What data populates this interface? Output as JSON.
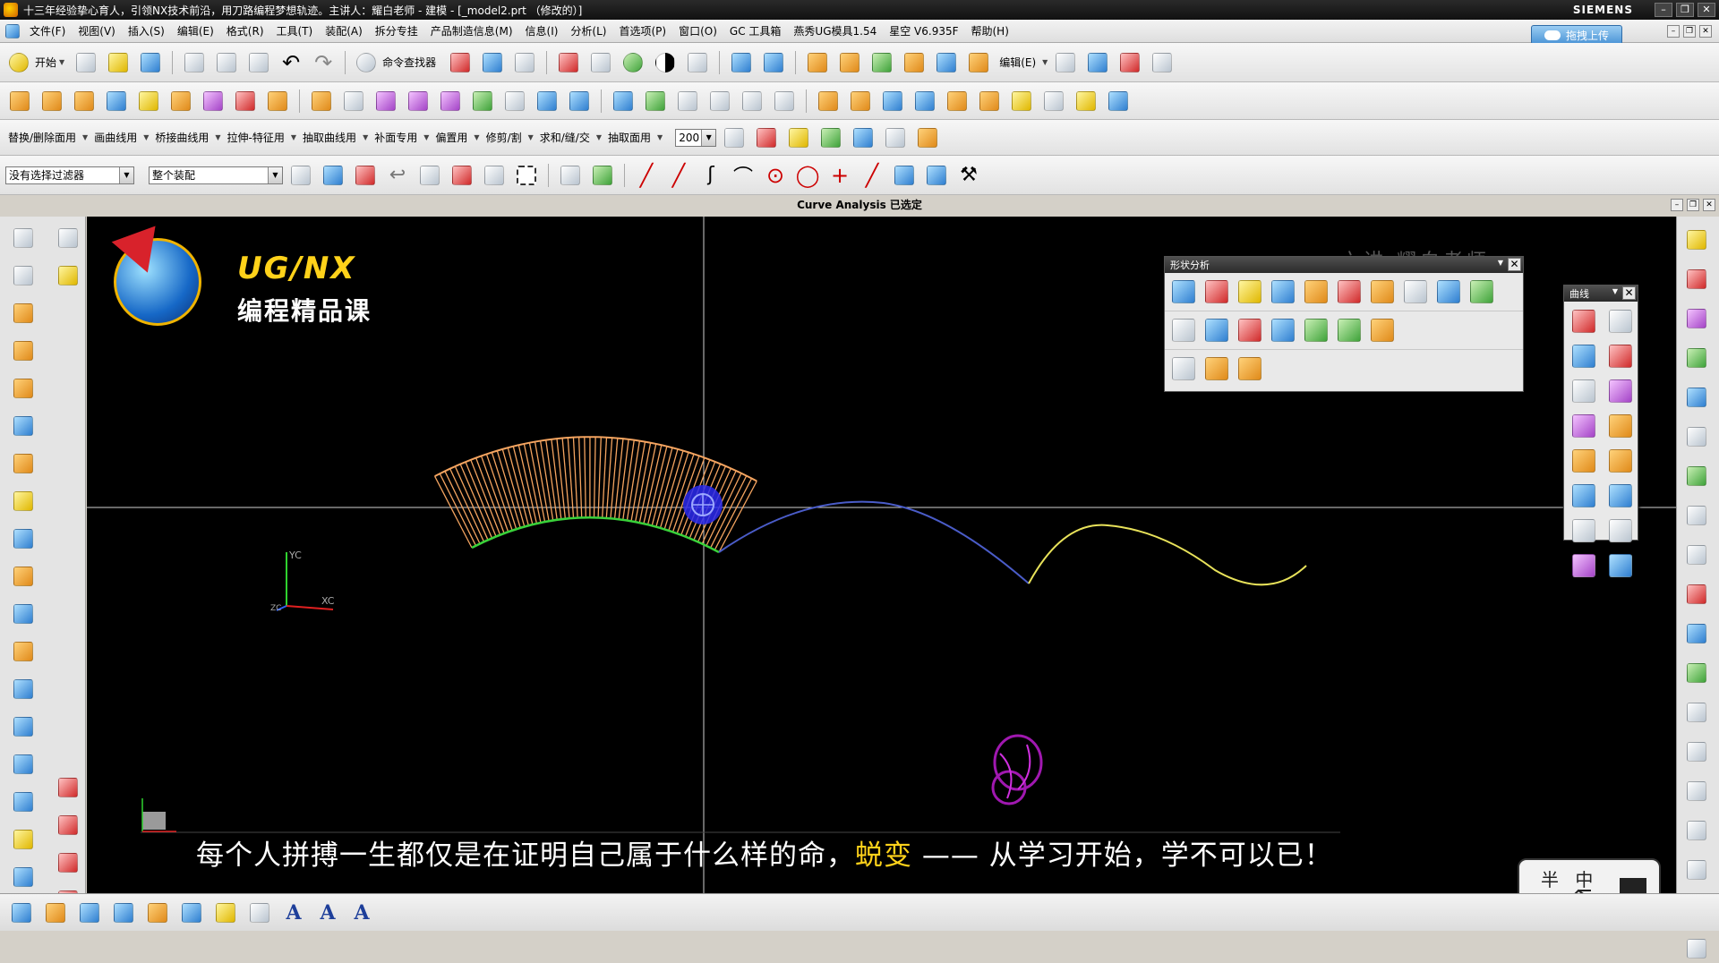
{
  "window": {
    "title": "十三年经验挚心育人，引领NX技术前沿，用刀路编程梦想轨迹。主讲人：耀白老师 - 建模 - [_model2.prt （修改的）]",
    "brand": "SIEMENS"
  },
  "menu": {
    "items": [
      "文件(F)",
      "视图(V)",
      "插入(S)",
      "编辑(E)",
      "格式(R)",
      "工具(T)",
      "装配(A)",
      "拆分专挂",
      "产品制造信息(M)",
      "信息(I)",
      "分析(L)",
      "首选项(P)",
      "窗口(O)",
      "GC 工具箱",
      "燕秀UG模具1.54",
      "星空 V6.935F",
      "帮助(H)"
    ],
    "upload_label": "拖拽上传"
  },
  "toolbar1": {
    "start_label": "开始",
    "command_finder_label": "命令查找器",
    "edit_label": "编辑(E)"
  },
  "toolbar3": {
    "items": [
      "替换/删除面用",
      "画曲线用",
      "桥接曲线用",
      "拉伸-特征用",
      "抽取曲线用",
      "补面专用",
      "偏置用",
      "修剪/割",
      "求和/缝/交",
      "抽取面用"
    ],
    "zoom_value": "200"
  },
  "toolbar4": {
    "filter_value": "没有选择过滤器",
    "scope_value": "整个装配"
  },
  "status": {
    "text": "Curve Analysis 已选定"
  },
  "viewport": {
    "logo_line1": "UG/NX",
    "logo_line2": "编程精品课",
    "faded_title": "六讲   耀白老师",
    "axis_yc": "YC",
    "axis_xc": "XC",
    "axis_zc": "ZC",
    "subtitle_part1": "每个人拼搏一生都仅是在证明自己属于什么样的命，",
    "subtitle_highlight": "蜕变",
    "subtitle_part2": " —— 从学习开始，学不可以已！",
    "watermark_text": "半 中",
    "colors": {
      "comb": "#f4a460",
      "curve_green": "#39d23a",
      "curve_blue": "#4a5cc8",
      "curve_yellow": "#e8e25a",
      "crosshair": "#d0d0d0"
    }
  },
  "shape_panel": {
    "title": "形状分析"
  },
  "curve_panel": {
    "title": "曲线"
  }
}
